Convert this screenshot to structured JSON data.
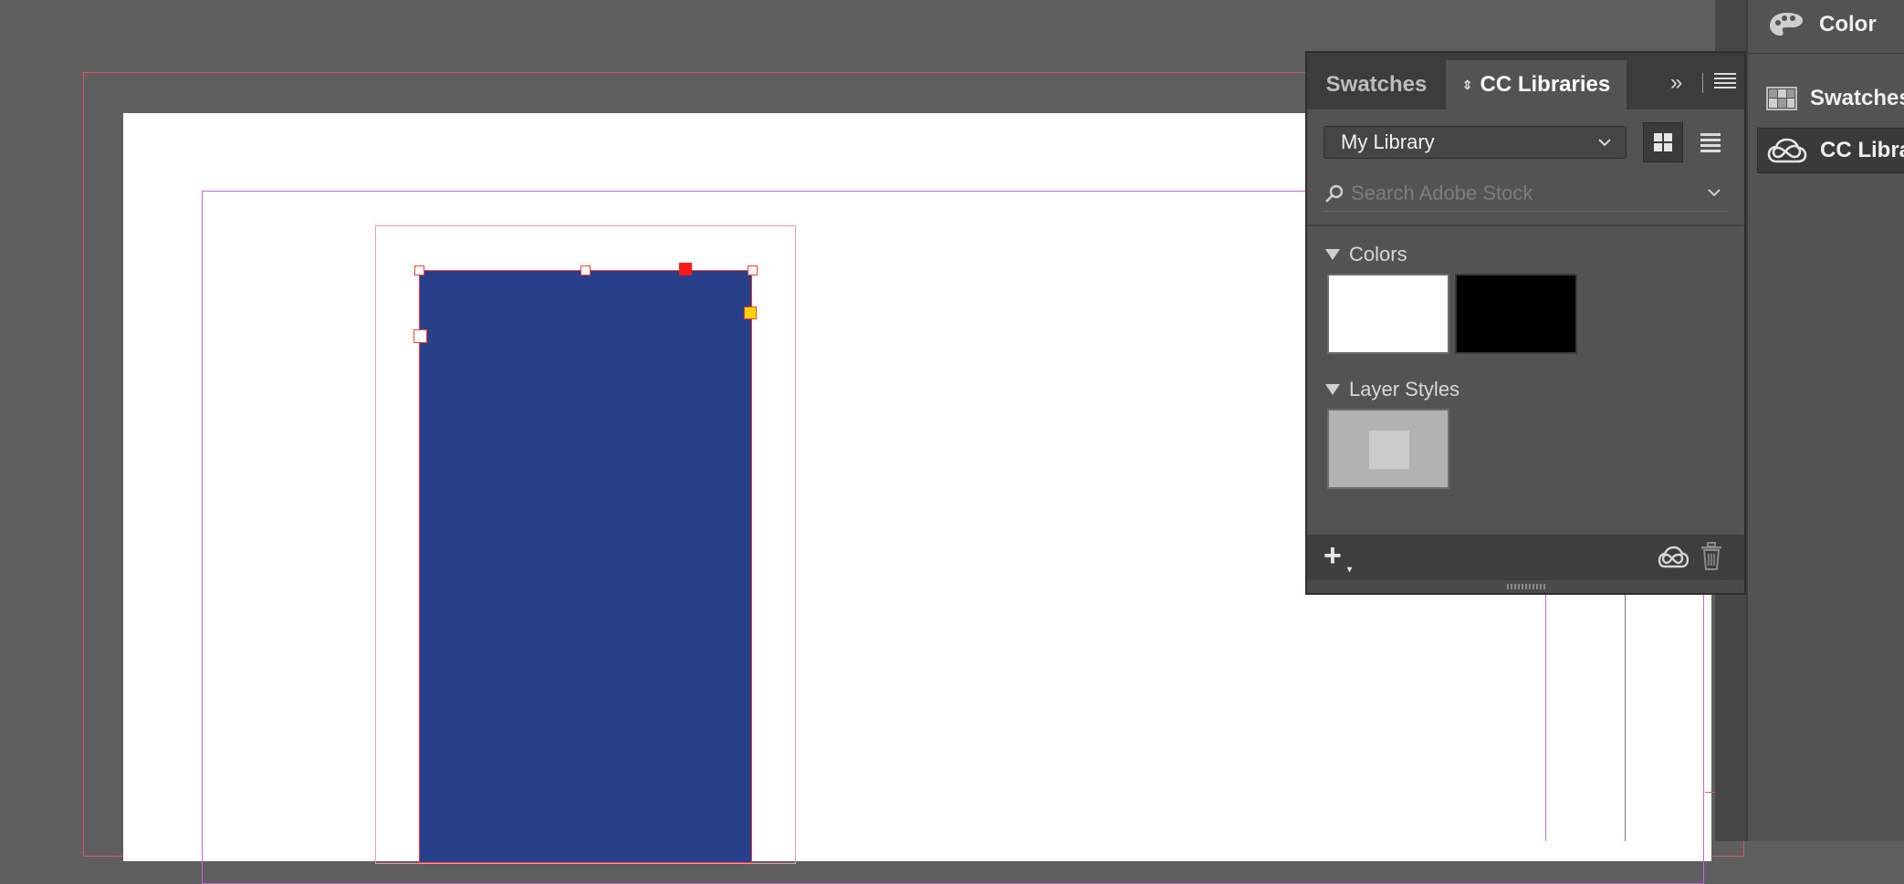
{
  "canvas": {
    "shape_fill_color": "#283f89",
    "selection_color": "#ff3b3b"
  },
  "panel": {
    "tabs": [
      {
        "label": "Swatches",
        "active": false
      },
      {
        "label": "CC Libraries",
        "active": true
      }
    ],
    "collapse_glyph": "»",
    "library_select": {
      "value": "My Library"
    },
    "view_buttons": [
      "grid-view-icon",
      "list-view-icon"
    ],
    "search": {
      "placeholder": "Search Adobe Stock"
    },
    "sections": {
      "colors": {
        "title": "Colors",
        "swatches": [
          {
            "name": "white",
            "hex": "#ffffff"
          },
          {
            "name": "black",
            "hex": "#000000"
          }
        ]
      },
      "layer_styles": {
        "title": "Layer Styles"
      }
    },
    "footer": {
      "add_label": "+",
      "add_sub": "▾"
    }
  },
  "dock": {
    "items": [
      {
        "label": "Color",
        "icon": "palette-icon"
      },
      {
        "label": "Swatches",
        "icon": "swatches-icon"
      },
      {
        "label": "CC Libraries",
        "icon": "creative-cloud-icon"
      }
    ]
  }
}
